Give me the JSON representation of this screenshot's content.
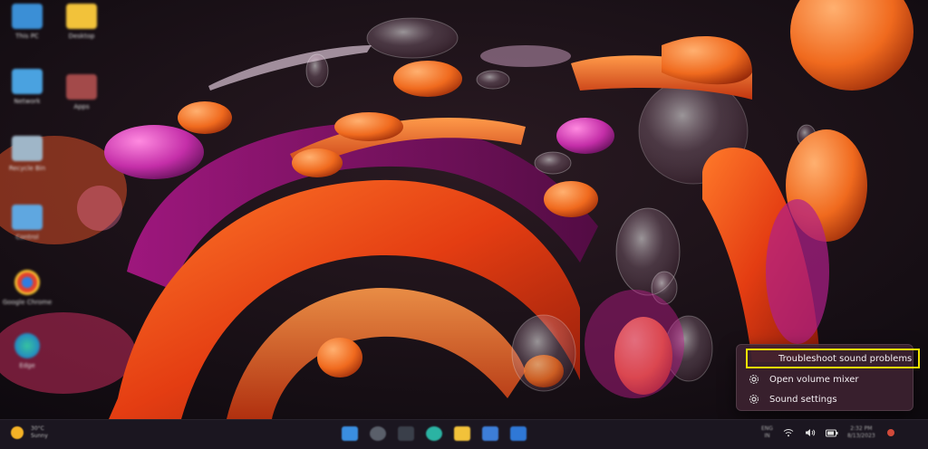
{
  "desktop": {
    "icons": [
      {
        "label": "This PC"
      },
      {
        "label": "Desktop"
      },
      {
        "label": "Network"
      },
      {
        "label": "Apps"
      },
      {
        "label": "Recycle Bin"
      },
      {
        "label": "Control"
      },
      {
        "label": "Google Chrome"
      },
      {
        "label": "Edge"
      }
    ]
  },
  "context_menu": {
    "items": [
      {
        "label": "Troubleshoot sound problems",
        "icon": "none"
      },
      {
        "label": "Open volume mixer",
        "icon": "gear-icon"
      },
      {
        "label": "Sound settings",
        "icon": "gear-icon"
      }
    ],
    "highlight_color": "#f2e400"
  },
  "taskbar": {
    "weather": {
      "temp": "30°C",
      "condition": "Sunny"
    },
    "tray": {
      "lang": "ENG",
      "region": "IN",
      "time": "2:32 PM",
      "date": "8/13/2023"
    },
    "accent": "#1b1620"
  }
}
